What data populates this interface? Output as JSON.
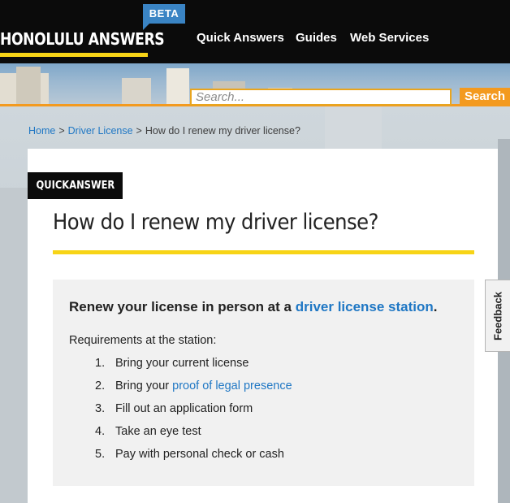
{
  "site": {
    "logo_text": "HONOLULU ANSWERS",
    "beta_label": "BETA"
  },
  "nav": {
    "items": [
      {
        "label": "Quick Answers"
      },
      {
        "label": "Guides"
      },
      {
        "label": "Web Services"
      }
    ]
  },
  "search": {
    "placeholder": "Search...",
    "button_label": "Search"
  },
  "breadcrumb": {
    "home": "Home",
    "separator": ">",
    "section": "Driver License",
    "current": "How do I renew my driver license?"
  },
  "article": {
    "tag": "QUICKANSWER",
    "title": "How do I renew my driver license?",
    "answer_lead": "Renew your license in person at a",
    "answer_link": "driver license station",
    "answer_end": ".",
    "requirements_label": "Requirements at the station:",
    "steps": [
      {
        "num": "1.",
        "text": "Bring your current license"
      },
      {
        "num": "2.",
        "text": "Bring your ",
        "link": "proof of legal presence"
      },
      {
        "num": "3.",
        "text": "Fill out an application form"
      },
      {
        "num": "4.",
        "text": "Take an eye test"
      },
      {
        "num": "5.",
        "text": "Pay with personal check or cash"
      }
    ]
  },
  "feedback": {
    "label": "Feedback"
  },
  "colors": {
    "accent_yellow": "#f7d417",
    "accent_orange": "#f39a1f",
    "link_blue": "#1f77c4",
    "beta_blue": "#3a84c4",
    "header_black": "#0b0b0b"
  }
}
